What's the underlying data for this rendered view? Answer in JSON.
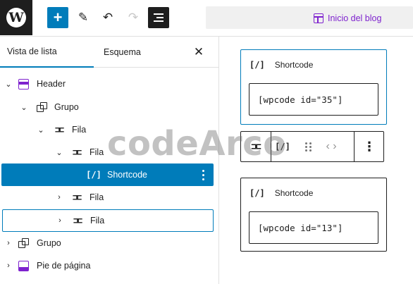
{
  "toolbar": {
    "logo_glyph": "W",
    "add_glyph": "+",
    "edit_glyph": "✎",
    "undo_glyph": "↶",
    "redo_glyph": "↷",
    "document_title": "Inicio del blog",
    "accent_color": "#007cba",
    "template_color": "#7e22ce"
  },
  "sidebar": {
    "tabs": [
      {
        "label": "Vista de lista",
        "active": true
      },
      {
        "label": "Esquema",
        "active": false
      }
    ],
    "close_glyph": "✕",
    "tree": [
      {
        "label": "Header",
        "icon": "template-part-header-icon",
        "chevron": "down"
      },
      {
        "label": "Grupo",
        "icon": "group-icon",
        "chevron": "down"
      },
      {
        "label": "Fila",
        "icon": "row-icon",
        "chevron": "down"
      },
      {
        "label": "Fila",
        "icon": "row-icon",
        "chevron": "down"
      },
      {
        "label": "Shortcode",
        "icon": "shortcode-icon",
        "chevron": "",
        "selected": true
      },
      {
        "label": "Fila",
        "icon": "row-icon",
        "chevron": "right"
      },
      {
        "label": "Fila",
        "icon": "row-icon",
        "chevron": "right",
        "highlighted": true
      },
      {
        "label": "Grupo",
        "icon": "group-icon",
        "chevron": "right"
      },
      {
        "label": "Pie de página",
        "icon": "template-part-footer-icon",
        "chevron": "right"
      }
    ],
    "row_icon_glyph": "⊐⊏",
    "shortcode_icon_glyph": "[/]",
    "chevron_down": "⌄",
    "chevron_right": "›"
  },
  "canvas": {
    "blocks": [
      {
        "title": "Shortcode",
        "icon_glyph": "[/]",
        "value": "[wpcode id=\"35\"]"
      },
      {
        "title": "Shortcode",
        "icon_glyph": "[/]",
        "value": "[wpcode id=\"13\"]"
      }
    ],
    "block_toolbar": {
      "parent_glyph": "⊐⊏",
      "block_glyph": "[/]",
      "move_glyph": "‹ ›",
      "options_glyph": "⋮"
    }
  },
  "watermark": {
    "text": "codeArco"
  }
}
